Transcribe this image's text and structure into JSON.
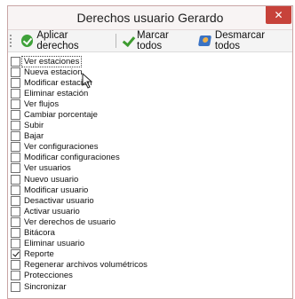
{
  "window": {
    "title": "Derechos usuario Gerardo",
    "close_symbol": "✕"
  },
  "toolbar": {
    "apply_label": "Aplicar derechos",
    "apply_icon": "apply-check-icon",
    "mark_all_label": "Marcar todos",
    "mark_all_icon": "green-check-icon",
    "unmark_all_label": "Desmarcar todos",
    "unmark_all_icon": "unmark-icon"
  },
  "permissions": [
    {
      "label": "Ver estaciones",
      "checked": false
    },
    {
      "label": "Nueva estacion",
      "checked": false
    },
    {
      "label": "Modificar estación",
      "checked": false
    },
    {
      "label": "Eliminar estación",
      "checked": false
    },
    {
      "label": "Ver flujos",
      "checked": false
    },
    {
      "label": "Cambiar porcentaje",
      "checked": false
    },
    {
      "label": "Subir",
      "checked": false
    },
    {
      "label": "Bajar",
      "checked": false
    },
    {
      "label": "Ver configuraciones",
      "checked": false
    },
    {
      "label": "Modificar configuraciones",
      "checked": false
    },
    {
      "label": "Ver usuarios",
      "checked": false
    },
    {
      "label": "Nuevo usuario",
      "checked": false
    },
    {
      "label": "Modificar usuario",
      "checked": false
    },
    {
      "label": "Desactivar usuario",
      "checked": false
    },
    {
      "label": "Activar usuario",
      "checked": false
    },
    {
      "label": "Ver derechos de usuario",
      "checked": false
    },
    {
      "label": "Bitácora",
      "checked": false
    },
    {
      "label": "Eliminar usuario",
      "checked": false
    },
    {
      "label": "Reporte",
      "checked": true
    },
    {
      "label": "Regenerar archivos volumétricos",
      "checked": false
    },
    {
      "label": "Protecciones",
      "checked": false
    },
    {
      "label": "Sincronizar",
      "checked": false
    }
  ],
  "colors": {
    "close_button": "#c7423a",
    "accent_green": "#3ea23a",
    "accent_blue": "#3a73c4"
  }
}
